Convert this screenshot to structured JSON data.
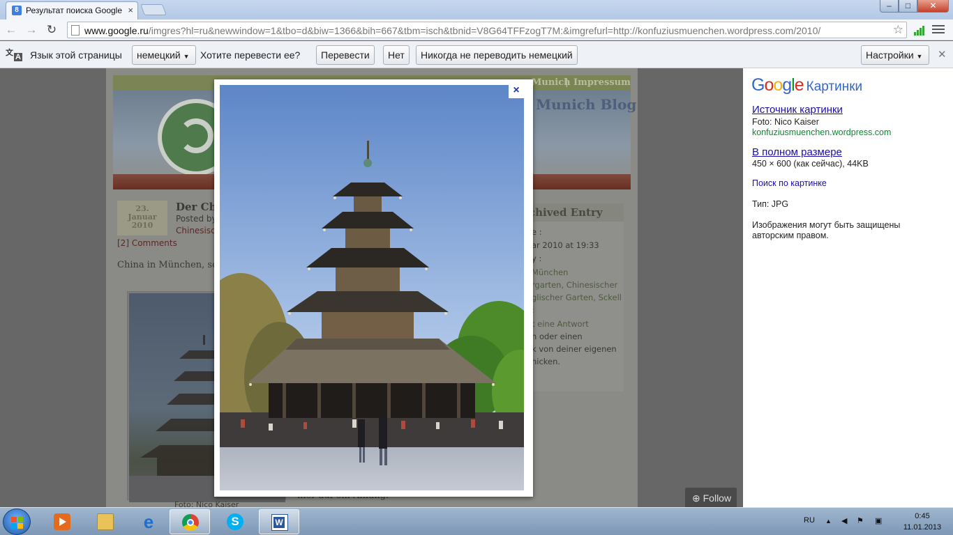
{
  "browser": {
    "tab_title": "Результат поиска Google",
    "tab_favicon": "8",
    "url_host": "www.google.ru",
    "url_rest": "/imgres?hl=ru&newwindow=1&tbo=d&biw=1366&bih=667&tbm=isch&tbnid=V8G64TFFzogT7M:&imgrefurl=http://konfuziusmuenchen.wordpress.com/2010/"
  },
  "translate_bar": {
    "label": "Язык этой страницы",
    "language": "немецкий",
    "question": "Хотите перевести ее?",
    "translate_button": "Перевести",
    "no_button": "Нет",
    "never_button": "Никогда не переводить немецкий",
    "settings_button": "Настройки"
  },
  "blog": {
    "nav_item_1": "Munich",
    "nav_separator": "|",
    "nav_item_2": "Impressum",
    "site_title": "Munich Blog",
    "date_day": "23.",
    "date_month": "Januar",
    "date_year": "2010",
    "post_title": "Der Ch",
    "posted_by": "Posted by",
    "category": "Chinesisch",
    "comments": "[2] Comments",
    "excerpt": "China in München, scho",
    "sidebar_header": "chived Entry",
    "sidebar_line_1": "e :",
    "sidebar_line_2": "ar 2010 at 19:33",
    "sidebar_line_3": "y :",
    "sidebar_line_4": "München",
    "sidebar_line_5": "rgarten, Chinesischer",
    "sidebar_line_6": "glischer Garten, Sckell",
    "sidebar_line_7": ":",
    "sidebar_line_8": "t eine Antwort",
    "sidebar_line_9": "n oder einen",
    "sidebar_line_10": "k von deiner eigenen",
    "sidebar_line_11": "hicken.",
    "caption": "Foto: Nico Kaiser",
    "bottom_text": "hier auf ein Anfang.",
    "follow": "Follow"
  },
  "lightbox": {
    "close_label": "×"
  },
  "info_panel": {
    "logo_google": "Google",
    "logo_suffix": "Картинки",
    "source_link": "Источник картинки",
    "photo_credit": "Foto: Nico Kaiser",
    "source_domain": "konfuziusmuenchen.wordpress.com",
    "fullsize_link": "В полном размере",
    "dimensions": "450 × 600 (как сейчас), 44KB",
    "search_by_image": "Поиск по картинке",
    "type_label": "Тип:  JPG",
    "copyright_line_1": "Изображения могут быть защищены",
    "copyright_line_2": "авторским правом."
  },
  "taskbar": {
    "lang": "RU",
    "time": "0:45",
    "date": "11.01.2013",
    "apps": [
      "media-player-icon",
      "file-explorer-icon",
      "internet-explorer-icon",
      "chrome-icon",
      "skype-icon",
      "word-icon"
    ]
  },
  "colors": {
    "google_blue": "#3366cc",
    "link_blue": "#1a0dab",
    "source_green": "#0a8a2e",
    "close_x": "#1a37c4"
  }
}
